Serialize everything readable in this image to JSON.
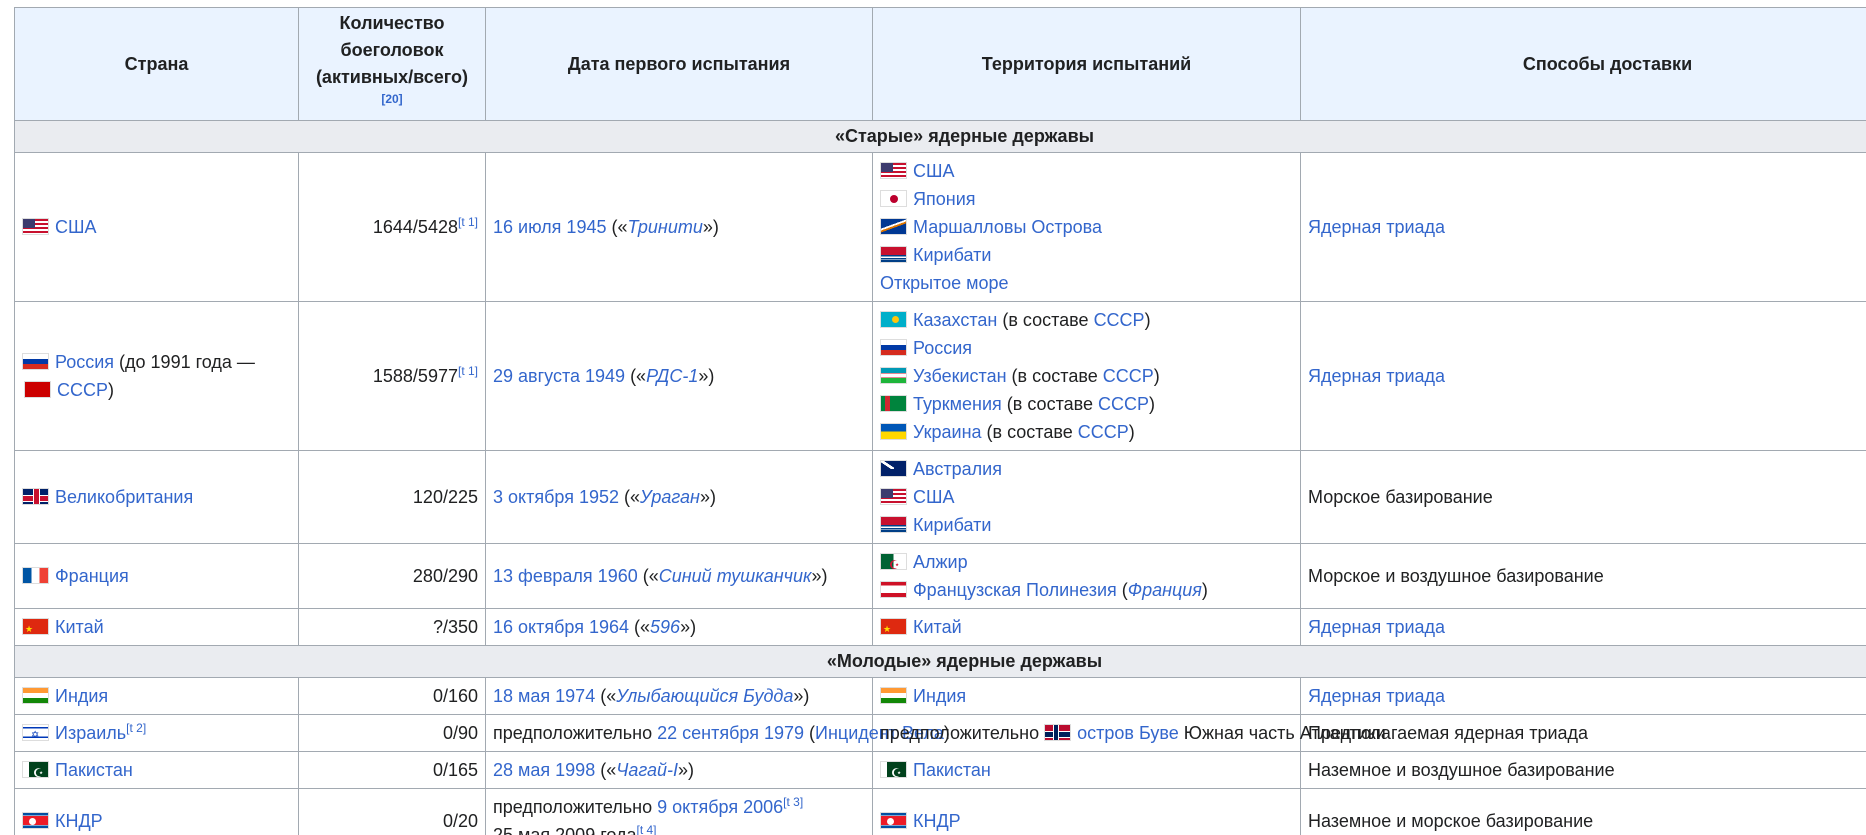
{
  "headers": {
    "country": "Страна",
    "warheads_line1": "Количество боеголовок",
    "warheads_line2": "(активных/всего)",
    "warheads_ref": "[20]",
    "first_test": "Дата первого испытания",
    "territory": "Территория испытаний",
    "delivery": "Способы доставки"
  },
  "sections": {
    "old": "«Старые» ядерные державы",
    "young": "«Молодые» ядерные державы"
  },
  "rows": {
    "usa": {
      "country": "США",
      "warheads": "1644/5428",
      "warheads_ref": "[t 1]",
      "date": "16 июля 1945",
      "date_pre": " («",
      "test_name": "Тринити",
      "date_post": "»)",
      "territory": [
        "США",
        "Япония",
        "Маршалловы Острова",
        "Кирибати",
        "Открытое море"
      ],
      "delivery": "Ядерная триада"
    },
    "russia": {
      "country": "Россия",
      "country_mid": " (до 1991 года — ",
      "country_ussr": "СССР",
      "country_end": ")",
      "warheads": "1588/5977",
      "warheads_ref": "[t 1]",
      "date": "29 августа 1949",
      "date_pre": " («",
      "test_name": "РДС-1",
      "date_post": "»)",
      "territory": [
        "Казахстан",
        "Россия",
        "Узбекистан",
        "Туркмения",
        "Украина"
      ],
      "territory_note_pre": " (в составе ",
      "territory_note_link": "СССР",
      "territory_note_post": ")",
      "delivery": "Ядерная триада"
    },
    "uk": {
      "country": "Великобритания",
      "warheads": "120/225",
      "date": "3 октября 1952",
      "date_pre": " («",
      "test_name": "Ураган",
      "date_post": "»)",
      "territory": [
        "Австралия",
        "США",
        "Кирибати"
      ],
      "delivery": "Морское базирование"
    },
    "france": {
      "country": "Франция",
      "warheads": "280/290",
      "date": "13 февраля 1960",
      "date_pre": " («",
      "test_name": "Синий тушканчик",
      "date_post": "»)",
      "territory": [
        "Алжир",
        "Французская Полинезия"
      ],
      "territory_note_pre": " (",
      "territory_note_link": "Франция",
      "territory_note_post": ")",
      "delivery": "Морское и воздушное базирование"
    },
    "china": {
      "country": "Китай",
      "warheads": "?/350",
      "date": "16 октября 1964",
      "date_pre": " («",
      "test_name": "596",
      "date_post": "»)",
      "territory": [
        "Китай"
      ],
      "delivery": "Ядерная триада"
    },
    "india": {
      "country": "Индия",
      "warheads": "0/160",
      "date": "18 мая 1974",
      "date_pre": " («",
      "test_name": "Улыбающийся Будда",
      "date_post": "»)",
      "territory": [
        "Индия"
      ],
      "delivery": "Ядерная триада"
    },
    "israel": {
      "country": "Израиль",
      "country_ref": "[t 2]",
      "warheads": "0/90",
      "date_prefix": "предположительно ",
      "date": "22 сентября 1979",
      "date_pre": " (",
      "test_name": "Инцидент Вела",
      "date_post": ")",
      "territory_prefix": "предположительно ",
      "territory": [
        "остров Буве"
      ],
      "territory_suffix": " Южная часть Атлантики",
      "delivery": "Предполагаемая ядерная триада"
    },
    "pakistan": {
      "country": "Пакистан",
      "warheads": "0/165",
      "date": "28 мая 1998",
      "date_pre": " («",
      "test_name": "Чагай-I",
      "date_post": "»)",
      "territory": [
        "Пакистан"
      ],
      "delivery": "Наземное и воздушное базирование"
    },
    "dprk": {
      "country": "КНДР",
      "warheads": "0/20",
      "date_prefix": "предположительно ",
      "date": "9 октября 2006",
      "date_ref": "[t 3]",
      "date2": "25 мая 2009 года",
      "date2_ref": "[t 4]",
      "territory": [
        "КНДР"
      ],
      "delivery": "Наземное и морское базирование"
    }
  }
}
